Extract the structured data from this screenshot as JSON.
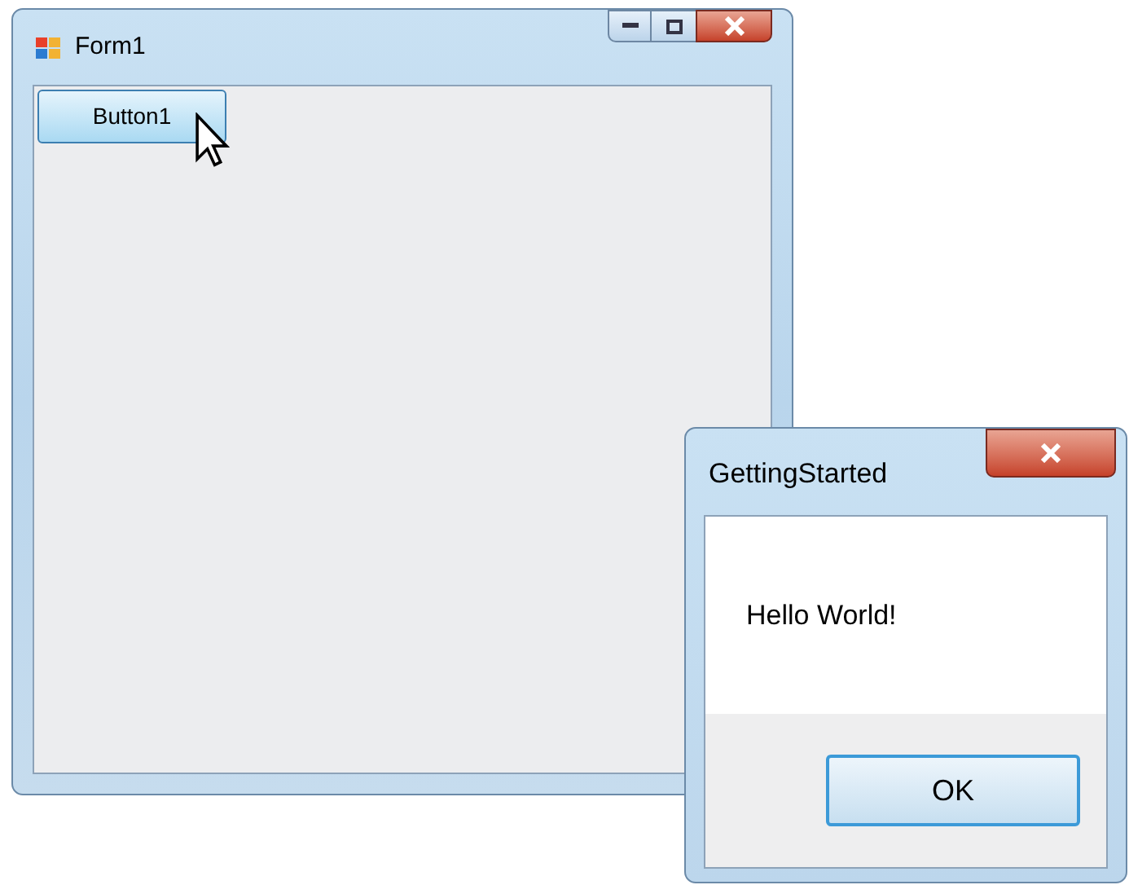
{
  "main_window": {
    "title": "Form1",
    "button": {
      "label": "Button1",
      "hovered": true
    }
  },
  "dialog": {
    "title": "GettingStarted",
    "message": "Hello World!",
    "ok_button": {
      "label": "OK",
      "focused": true
    }
  }
}
